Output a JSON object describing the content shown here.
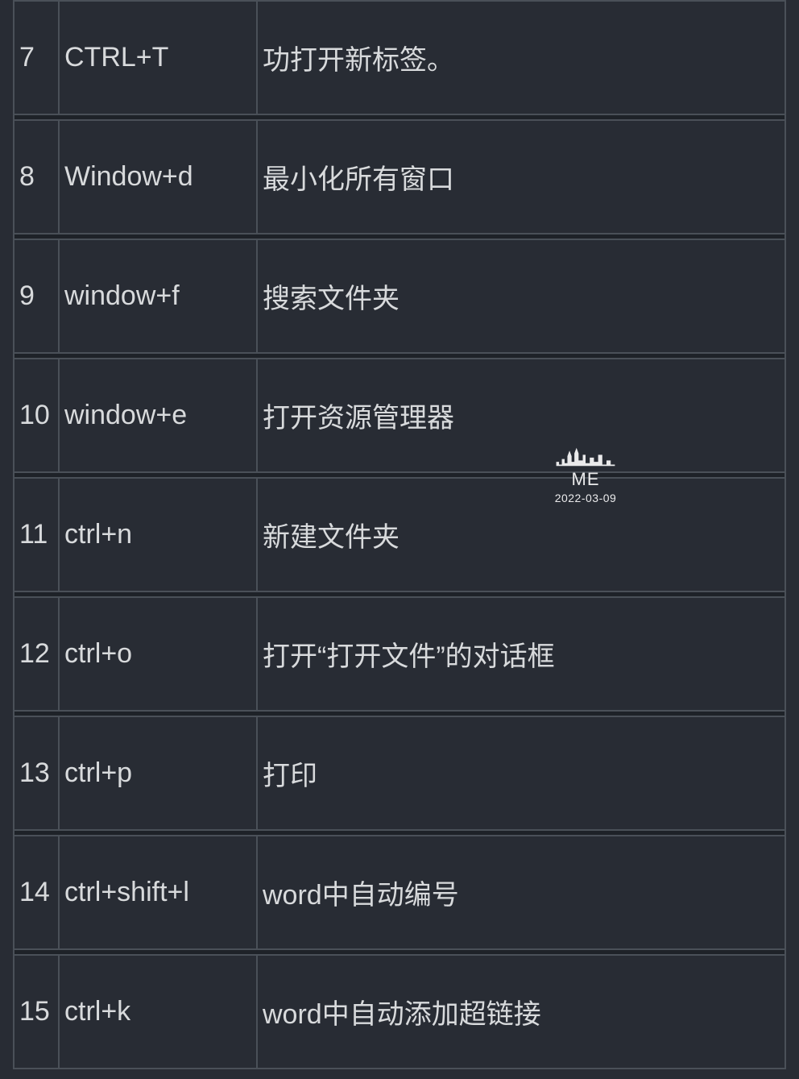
{
  "rows": [
    {
      "num": "7",
      "shortcut": "CTRL+T",
      "desc": "功打开新标签。"
    },
    {
      "num": "8",
      "shortcut": "Window+d",
      "desc": "最小化所有窗口"
    },
    {
      "num": "9",
      "shortcut": "window+f",
      "desc": "搜索文件夹"
    },
    {
      "num": "10",
      "shortcut": "window+e",
      "desc": "打开资源管理器"
    },
    {
      "num": "11",
      "shortcut": "ctrl+n",
      "desc": "新建文件夹"
    },
    {
      "num": "12",
      "shortcut": "ctrl+o",
      "desc": "打开“打开文件”的对话框"
    },
    {
      "num": "13",
      "shortcut": "ctrl+p",
      "desc": "打印"
    },
    {
      "num": "14",
      "shortcut": "ctrl+shift+l",
      "desc": "word中自动编号"
    },
    {
      "num": "15",
      "shortcut": "ctrl+k",
      "desc": "word中自动添加超链接"
    }
  ],
  "watermark": {
    "label": "ME",
    "date": "2022-03-09"
  }
}
